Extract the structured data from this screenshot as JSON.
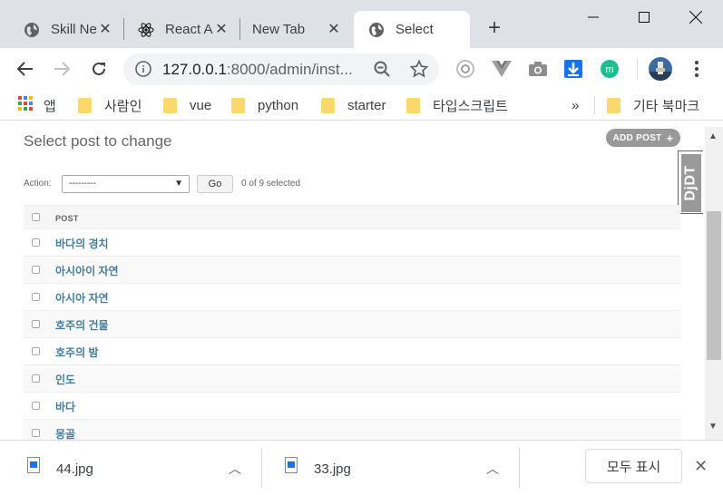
{
  "tabs": [
    {
      "title": "Skill Ne",
      "icon": "globe-icon"
    },
    {
      "title": "React A",
      "icon": "react-icon"
    },
    {
      "title": "New Tab",
      "icon": ""
    },
    {
      "title": "Select",
      "icon": "globe-icon",
      "active": true
    }
  ],
  "toolbar": {
    "url_host": "127.0.0.1",
    "url_rest": ":8000/admin/inst..."
  },
  "bookmarks": {
    "apps_label": "앱",
    "items": [
      "사람인",
      "vue",
      "python",
      "starter",
      "타입스크립트"
    ],
    "overflow": "»",
    "other_label": "기타 북마크"
  },
  "page": {
    "title": "Select post to change",
    "add_button": "ADD POST",
    "action_label": "Action:",
    "action_value": "---------",
    "go_label": "Go",
    "selected_count": "0 of 9 selected",
    "column_header": "POST",
    "rows": [
      "바다의 경치",
      "아시아이 자연",
      "아시아 자연",
      "호주의 건물",
      "호주의 밤",
      "인도",
      "바다",
      "몽골"
    ],
    "djdt_label": "DjDT"
  },
  "downloads": {
    "files": [
      "44.jpg",
      "33.jpg"
    ],
    "show_all": "모두 표시"
  },
  "colors": {
    "link": "#447e9b",
    "tabstrip": "#dee1e6",
    "folder": "#fbd86b"
  }
}
